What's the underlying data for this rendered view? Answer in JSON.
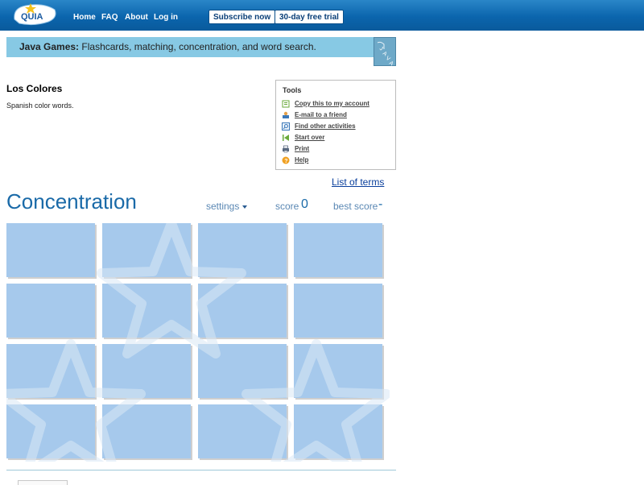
{
  "header": {
    "logo_text": "QUIA",
    "nav": [
      "Home",
      "FAQ",
      "About",
      "Log in"
    ],
    "subscribe_label": "Subscribe now",
    "trial_label": "30-day free trial"
  },
  "banner": {
    "bold": "Java Games:",
    "text": " Flashcards, matching, concentration, and word search.",
    "badge_text": "JAVA"
  },
  "activity": {
    "title": "Los Colores",
    "description": "Spanish color words."
  },
  "tools": {
    "heading": "Tools",
    "items": [
      {
        "label": "Copy this to my account",
        "icon": "copy-icon",
        "color": "#6aaa3a"
      },
      {
        "label": "E-mail to a friend",
        "icon": "email-icon",
        "color": "#3b78b8"
      },
      {
        "label": "Find other activities",
        "icon": "search-icon",
        "color": "#3b78b8"
      },
      {
        "label": "Start over",
        "icon": "rewind-icon",
        "color": "#6aaa3a"
      },
      {
        "label": "Print",
        "icon": "printer-icon",
        "color": "#5a6a80"
      },
      {
        "label": "Help",
        "icon": "help-icon",
        "color": "#f0a020"
      }
    ]
  },
  "list_of_terms": "List of terms",
  "game": {
    "title": "Concentration",
    "settings_label": "settings",
    "score_label": "score",
    "score_value": "0",
    "best_label": "best score",
    "best_value": "-",
    "rows": 4,
    "cols": 4,
    "card_color": "#a6c9ec"
  },
  "colors": {
    "nav_bar": "#0b65ad",
    "banner": "#87c9e4",
    "accent": "#1a6aa8"
  }
}
